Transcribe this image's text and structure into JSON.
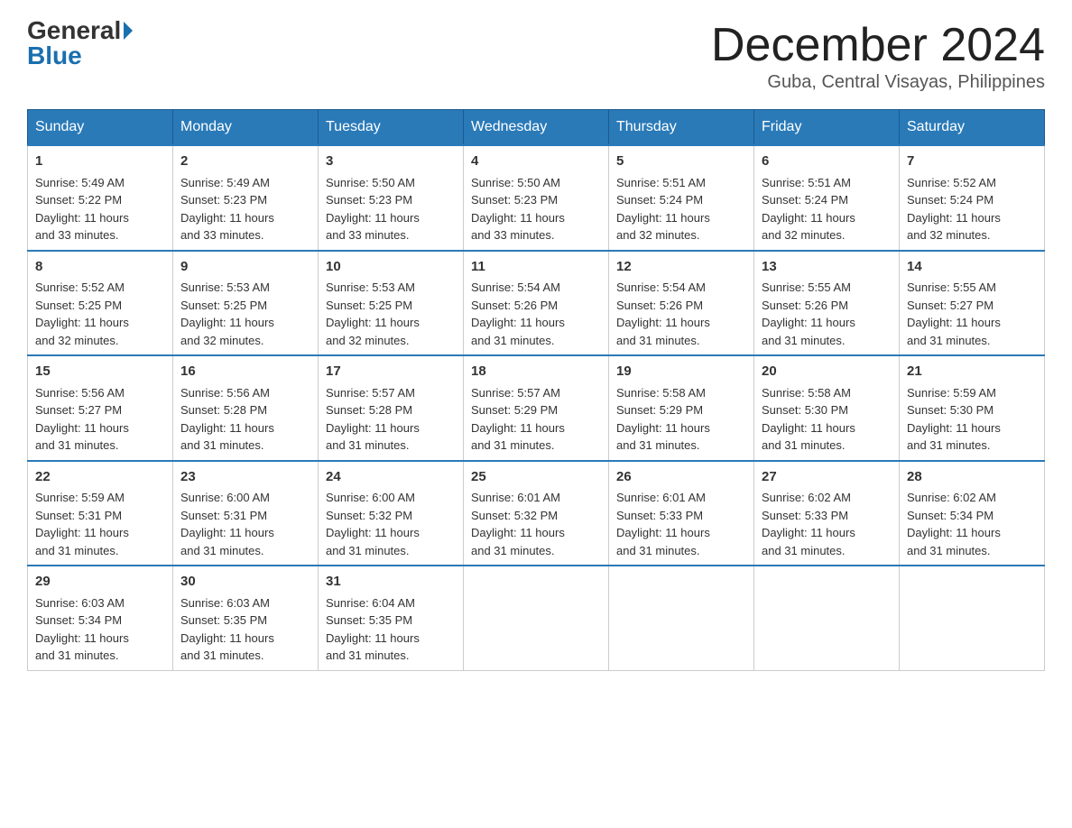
{
  "header": {
    "logo_general": "General",
    "logo_blue": "Blue",
    "title": "December 2024",
    "location": "Guba, Central Visayas, Philippines"
  },
  "days_of_week": [
    "Sunday",
    "Monday",
    "Tuesday",
    "Wednesday",
    "Thursday",
    "Friday",
    "Saturday"
  ],
  "weeks": [
    [
      {
        "day": "1",
        "sunrise": "5:49 AM",
        "sunset": "5:22 PM",
        "daylight": "11 hours and 33 minutes."
      },
      {
        "day": "2",
        "sunrise": "5:49 AM",
        "sunset": "5:23 PM",
        "daylight": "11 hours and 33 minutes."
      },
      {
        "day": "3",
        "sunrise": "5:50 AM",
        "sunset": "5:23 PM",
        "daylight": "11 hours and 33 minutes."
      },
      {
        "day": "4",
        "sunrise": "5:50 AM",
        "sunset": "5:23 PM",
        "daylight": "11 hours and 33 minutes."
      },
      {
        "day": "5",
        "sunrise": "5:51 AM",
        "sunset": "5:24 PM",
        "daylight": "11 hours and 32 minutes."
      },
      {
        "day": "6",
        "sunrise": "5:51 AM",
        "sunset": "5:24 PM",
        "daylight": "11 hours and 32 minutes."
      },
      {
        "day": "7",
        "sunrise": "5:52 AM",
        "sunset": "5:24 PM",
        "daylight": "11 hours and 32 minutes."
      }
    ],
    [
      {
        "day": "8",
        "sunrise": "5:52 AM",
        "sunset": "5:25 PM",
        "daylight": "11 hours and 32 minutes."
      },
      {
        "day": "9",
        "sunrise": "5:53 AM",
        "sunset": "5:25 PM",
        "daylight": "11 hours and 32 minutes."
      },
      {
        "day": "10",
        "sunrise": "5:53 AM",
        "sunset": "5:25 PM",
        "daylight": "11 hours and 32 minutes."
      },
      {
        "day": "11",
        "sunrise": "5:54 AM",
        "sunset": "5:26 PM",
        "daylight": "11 hours and 31 minutes."
      },
      {
        "day": "12",
        "sunrise": "5:54 AM",
        "sunset": "5:26 PM",
        "daylight": "11 hours and 31 minutes."
      },
      {
        "day": "13",
        "sunrise": "5:55 AM",
        "sunset": "5:26 PM",
        "daylight": "11 hours and 31 minutes."
      },
      {
        "day": "14",
        "sunrise": "5:55 AM",
        "sunset": "5:27 PM",
        "daylight": "11 hours and 31 minutes."
      }
    ],
    [
      {
        "day": "15",
        "sunrise": "5:56 AM",
        "sunset": "5:27 PM",
        "daylight": "11 hours and 31 minutes."
      },
      {
        "day": "16",
        "sunrise": "5:56 AM",
        "sunset": "5:28 PM",
        "daylight": "11 hours and 31 minutes."
      },
      {
        "day": "17",
        "sunrise": "5:57 AM",
        "sunset": "5:28 PM",
        "daylight": "11 hours and 31 minutes."
      },
      {
        "day": "18",
        "sunrise": "5:57 AM",
        "sunset": "5:29 PM",
        "daylight": "11 hours and 31 minutes."
      },
      {
        "day": "19",
        "sunrise": "5:58 AM",
        "sunset": "5:29 PM",
        "daylight": "11 hours and 31 minutes."
      },
      {
        "day": "20",
        "sunrise": "5:58 AM",
        "sunset": "5:30 PM",
        "daylight": "11 hours and 31 minutes."
      },
      {
        "day": "21",
        "sunrise": "5:59 AM",
        "sunset": "5:30 PM",
        "daylight": "11 hours and 31 minutes."
      }
    ],
    [
      {
        "day": "22",
        "sunrise": "5:59 AM",
        "sunset": "5:31 PM",
        "daylight": "11 hours and 31 minutes."
      },
      {
        "day": "23",
        "sunrise": "6:00 AM",
        "sunset": "5:31 PM",
        "daylight": "11 hours and 31 minutes."
      },
      {
        "day": "24",
        "sunrise": "6:00 AM",
        "sunset": "5:32 PM",
        "daylight": "11 hours and 31 minutes."
      },
      {
        "day": "25",
        "sunrise": "6:01 AM",
        "sunset": "5:32 PM",
        "daylight": "11 hours and 31 minutes."
      },
      {
        "day": "26",
        "sunrise": "6:01 AM",
        "sunset": "5:33 PM",
        "daylight": "11 hours and 31 minutes."
      },
      {
        "day": "27",
        "sunrise": "6:02 AM",
        "sunset": "5:33 PM",
        "daylight": "11 hours and 31 minutes."
      },
      {
        "day": "28",
        "sunrise": "6:02 AM",
        "sunset": "5:34 PM",
        "daylight": "11 hours and 31 minutes."
      }
    ],
    [
      {
        "day": "29",
        "sunrise": "6:03 AM",
        "sunset": "5:34 PM",
        "daylight": "11 hours and 31 minutes."
      },
      {
        "day": "30",
        "sunrise": "6:03 AM",
        "sunset": "5:35 PM",
        "daylight": "11 hours and 31 minutes."
      },
      {
        "day": "31",
        "sunrise": "6:04 AM",
        "sunset": "5:35 PM",
        "daylight": "11 hours and 31 minutes."
      },
      null,
      null,
      null,
      null
    ]
  ],
  "labels": {
    "sunrise": "Sunrise:",
    "sunset": "Sunset:",
    "daylight": "Daylight:"
  }
}
